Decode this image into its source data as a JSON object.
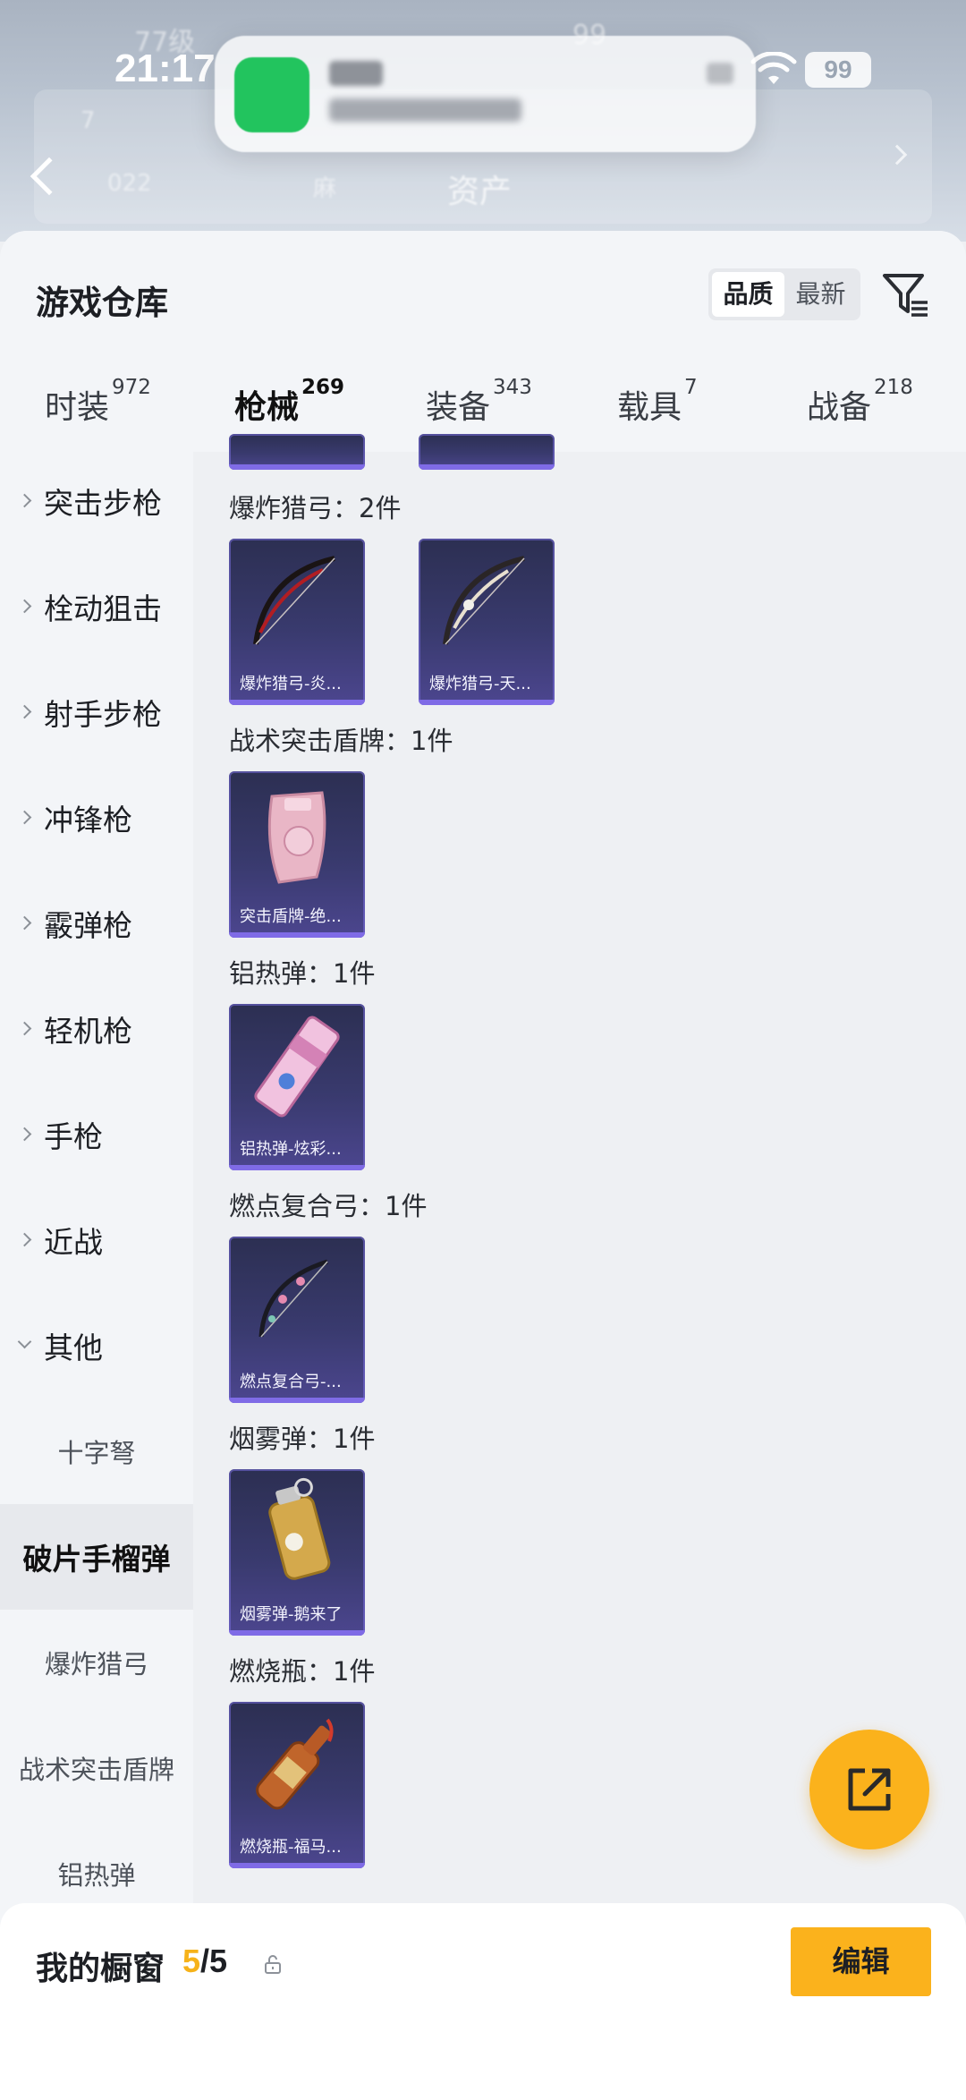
{
  "status_bar": {
    "time": "21:17",
    "battery": "99"
  },
  "header": {
    "back_label": "",
    "assets_label": "资产"
  },
  "warehouse": {
    "title": "游戏仓库",
    "sort_options": [
      "品质",
      "最新"
    ],
    "active_sort": "品质"
  },
  "tabs": [
    {
      "label": "时装",
      "count": "972"
    },
    {
      "label": "枪械",
      "count": "269"
    },
    {
      "label": "装备",
      "count": "343"
    },
    {
      "label": "载具",
      "count": "7"
    },
    {
      "label": "战备",
      "count": "218"
    }
  ],
  "active_tab": "枪械",
  "sidebar": {
    "categories": [
      "突击步枪",
      "栓动狙击",
      "射手步枪",
      "冲锋枪",
      "霰弹枪",
      "轻机枪",
      "手枪",
      "近战",
      "其他"
    ],
    "subcategories": [
      "十字弩",
      "破片手榴弹",
      "爆炸猎弓",
      "战术突击盾牌",
      "铝热弹"
    ],
    "selected": "破片手榴弹"
  },
  "groups": [
    {
      "title": "爆炸猎弓：2件",
      "items": [
        "爆炸猎弓-炎...",
        "爆炸猎弓-天..."
      ]
    },
    {
      "title": "战术突击盾牌：1件",
      "items": [
        "突击盾牌-绝..."
      ]
    },
    {
      "title": "铝热弹：1件",
      "items": [
        "铝热弹-炫彩..."
      ]
    },
    {
      "title": "燃点复合弓：1件",
      "items": [
        "燃点复合弓-..."
      ]
    },
    {
      "title": "烟雾弹：1件",
      "items": [
        "烟雾弹-鹅来了"
      ]
    },
    {
      "title": "燃烧瓶：1件",
      "items": [
        "燃烧瓶-福马..."
      ]
    }
  ],
  "showcase": {
    "title": "我的橱窗",
    "current": "5",
    "total": "/5",
    "edit_label": "编辑"
  },
  "colors": {
    "accent": "#fbb21c",
    "card_bg": "#393a6e",
    "card_border": "#7f6be6"
  }
}
